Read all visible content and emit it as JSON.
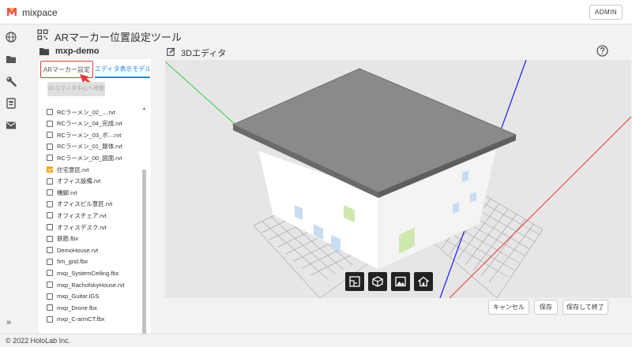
{
  "app": {
    "name": "mixpace",
    "admin_label": "ADMIN"
  },
  "sidebar": {
    "icons": [
      "globe-icon",
      "folder-icon",
      "wrench-icon",
      "badge-icon",
      "mail-icon"
    ],
    "expand_label": "»"
  },
  "tool": {
    "title": "ARマーカー位置設定ツール"
  },
  "project": {
    "name": "mxp-demo"
  },
  "panel": {
    "tabs": [
      {
        "label": "ARマーカー設定",
        "active": false
      },
      {
        "label": "エディタ表示モデル",
        "active": true
      }
    ],
    "center_button_label": "3Dエディタ中心へ移動",
    "files": [
      {
        "label": "RCラーメン_02_....rvt",
        "checked": false
      },
      {
        "label": "RCラーメン_04_完成.rvt",
        "checked": false
      },
      {
        "label": "RCラーメン_03_ボ....rvt",
        "checked": false
      },
      {
        "label": "RCラーメン_01_躯体.rvt",
        "checked": false
      },
      {
        "label": "RCラーメン_00_図面.rvt",
        "checked": false
      },
      {
        "label": "住宅意匠.rvt",
        "checked": true
      },
      {
        "label": "オフィス設備.rvt",
        "checked": false
      },
      {
        "label": "橋脚.rvt",
        "checked": false
      },
      {
        "label": "オフィスビル意匠.rvt",
        "checked": false
      },
      {
        "label": "オフィスチェア.rvt",
        "checked": false
      },
      {
        "label": "オフィスデスク.rvt",
        "checked": false
      },
      {
        "label": "鉄筋.fbx",
        "checked": false
      },
      {
        "label": "DemoHouse.rvt",
        "checked": false
      },
      {
        "label": "5m_grid.fbx",
        "checked": false
      },
      {
        "label": "mxp_SystemCeiling.fbx",
        "checked": false
      },
      {
        "label": "mxp_RachofskyHouse.rvt",
        "checked": false
      },
      {
        "label": "mxp_Guitar.IGS",
        "checked": false
      },
      {
        "label": "mxp_Drone.fbx",
        "checked": false
      },
      {
        "label": "mxp_C-armCT.fbx",
        "checked": false
      }
    ]
  },
  "editor": {
    "title": "3Dエディタ",
    "toolbar_icons": [
      "floorplan-icon",
      "marker-icon",
      "image-icon",
      "home-icon"
    ]
  },
  "actions": {
    "cancel": "キャンセル",
    "save": "保存",
    "save_exit": "保存して終了"
  },
  "footer": {
    "copyright": "© 2022 HoloLab Inc."
  },
  "colors": {
    "accent": "#1e88e5",
    "highlight": "#e53935",
    "checked": "#f5a623"
  }
}
